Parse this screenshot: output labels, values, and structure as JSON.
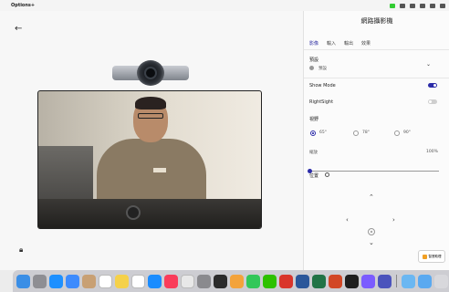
{
  "menubar": {
    "apple_icon": "apple-icon",
    "app_name": "Options+"
  },
  "main": {
    "back_icon": "arrow-left-icon",
    "bottom_icon": "lock-icon"
  },
  "panel": {
    "title": "網路攝影機",
    "tabs": [
      {
        "label": "影像",
        "active": true
      },
      {
        "label": "輸入"
      },
      {
        "label": "輸出"
      },
      {
        "label": "效果"
      }
    ],
    "preset_label": "預設",
    "preset_value": "預設",
    "show_mode_label": "Show Mode",
    "show_mode_on": true,
    "rightsight_label": "RightSight",
    "rightsight_on": false,
    "fov_label": "視野",
    "fov_options": [
      {
        "label": "65°",
        "selected": true
      },
      {
        "label": "78°",
        "selected": false
      },
      {
        "label": "90°",
        "selected": false
      }
    ],
    "zoom_label": "縮放",
    "zoom_value": "100%",
    "zoom_level": 0,
    "position_label": "位置",
    "helper_label": "智慧助理"
  },
  "colors": {
    "accent": "#2b2ba8",
    "menubar": "#f4f4f4",
    "panel": "#fbfbfb"
  },
  "dock": {
    "icons": [
      "finder",
      "launchpad",
      "safari",
      "mail",
      "contacts",
      "calendar",
      "notes",
      "reminders",
      "app-store",
      "music",
      "chrome",
      "settings",
      "logi-options",
      "photos",
      "messages",
      "wechat",
      "wps",
      "word",
      "excel",
      "powerpoint",
      "terminal",
      "messenger",
      "teams",
      "folder",
      "downloads",
      "trash"
    ]
  }
}
